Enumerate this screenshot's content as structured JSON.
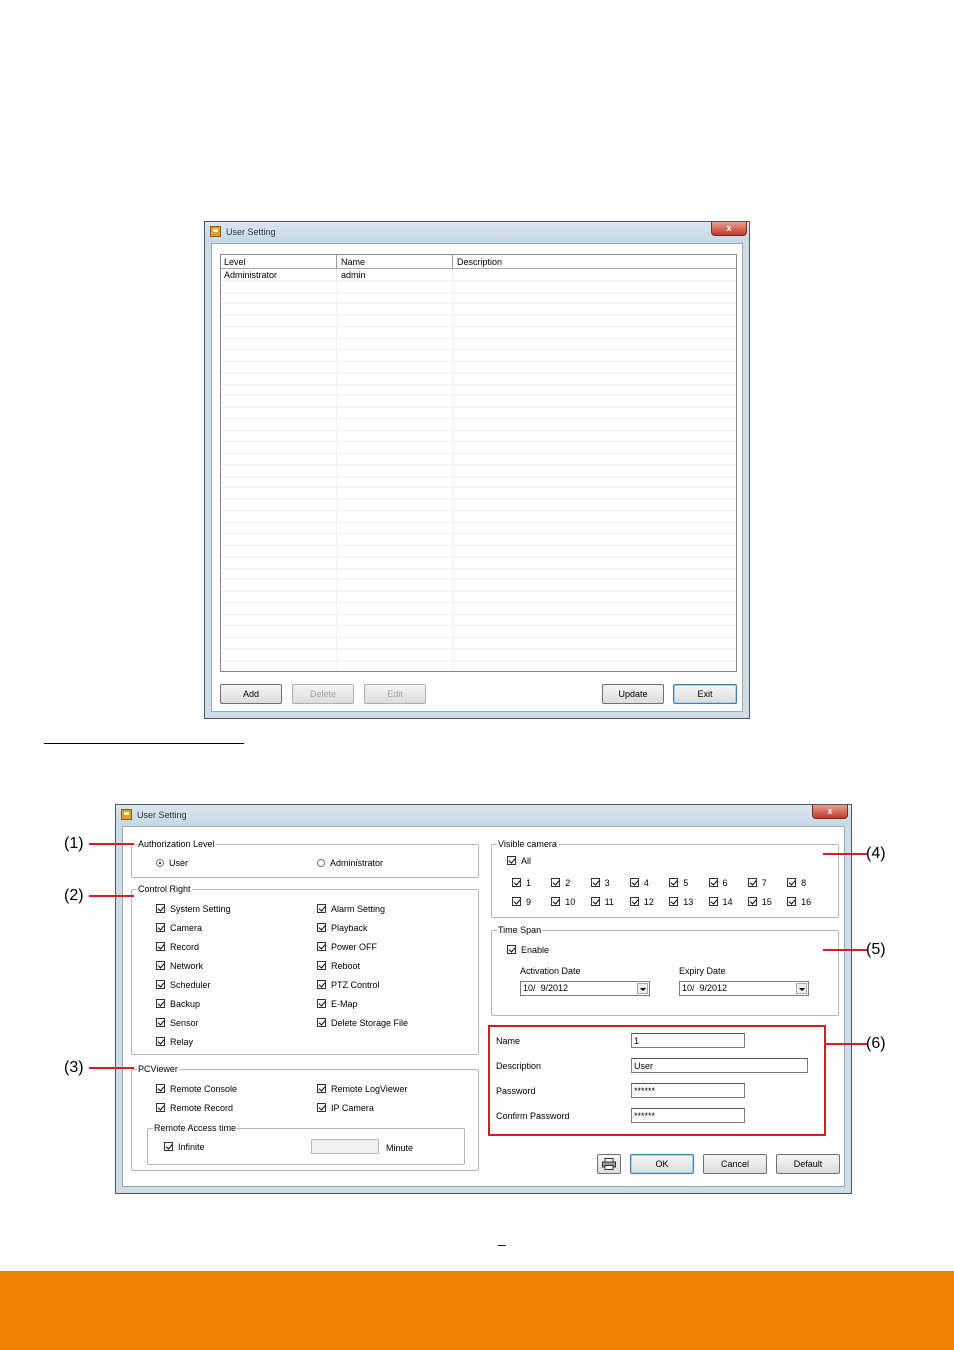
{
  "window1": {
    "title": "User Setting",
    "close_label": "x",
    "columns": [
      "Level",
      "Name",
      "Description"
    ],
    "rows": [
      {
        "level": "Administrator",
        "name": "admin",
        "description": ""
      }
    ],
    "buttons": {
      "add": "Add",
      "delete": "Delete",
      "edit": "Edit",
      "update": "Update",
      "exit": "Exit"
    }
  },
  "window2": {
    "title": "User Setting",
    "close_label": "x",
    "authorization": {
      "legend": "Authorization Level",
      "user": "User",
      "administrator": "Administrator",
      "selected": "User"
    },
    "control_right": {
      "legend": "Control Right",
      "left": [
        "System Setting",
        "Camera",
        "Record",
        "Network",
        "Scheduler",
        "Backup",
        "Sensor",
        "Relay"
      ],
      "right": [
        "Alarm Setting",
        "Playback",
        "Power OFF",
        "Reboot",
        "PTZ Control",
        "E-Map",
        "Delete Storage File"
      ]
    },
    "pcviewer": {
      "legend": "PCViewer",
      "remote_console": "Remote Console",
      "remote_logviewer": "Remote LogViewer",
      "remote_record": "Remote Record",
      "ip_camera": "IP Camera",
      "remote_access": {
        "legend": "Remote Access time",
        "infinite": "Infinite",
        "minute_value": "",
        "minute_label": "Minute"
      }
    },
    "visible_camera": {
      "legend": "Visible camera",
      "all": "All",
      "row1": [
        "1",
        "2",
        "3",
        "4",
        "5",
        "6",
        "7",
        "8"
      ],
      "row2": [
        "9",
        "10",
        "11",
        "12",
        "13",
        "14",
        "15",
        "16"
      ]
    },
    "time_span": {
      "legend": "Time Span",
      "enable": "Enable",
      "activation_label": "Activation Date",
      "activation_value": "10/  9/2012",
      "expiry_label": "Expiry Date",
      "expiry_value": "10/  9/2012"
    },
    "account": {
      "name_label": "Name",
      "name_value": "1",
      "description_label": "Description",
      "description_value": "User",
      "password_label": "Password",
      "password_value": "******",
      "confirm_label": "Confirm Password",
      "confirm_value": "******"
    },
    "buttons": {
      "ok": "OK",
      "cancel": "Cancel",
      "default": "Default"
    }
  },
  "callouts": [
    "(1)",
    "(2)",
    "(3)",
    "(4)",
    "(5)",
    "(6)"
  ],
  "page_mark": "_",
  "colors": {
    "callout_red": "#d0202a",
    "footer_orange": "#ee8100"
  }
}
